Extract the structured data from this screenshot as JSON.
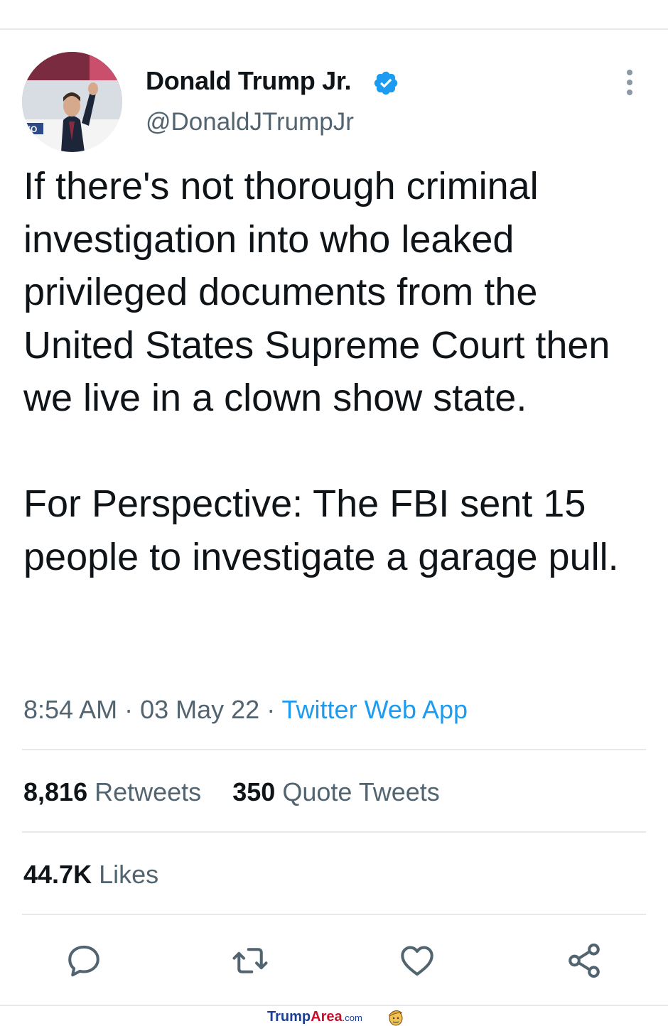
{
  "author": {
    "name": "Donald Trump Jr.",
    "handle": "@DonaldJTrumpJr",
    "verified": true,
    "avatar_icon": "profile-photo",
    "avatar_text": "YO"
  },
  "tweet": {
    "text": "If there's not thorough criminal investigation into who leaked privileged documents from the United States Supreme Court then we live in a clown show state.\n\nFor Perspective: The FBI sent 15 people to investigate a garage pull."
  },
  "meta": {
    "time": "8:54 AM",
    "date": "03 May 22",
    "separator": " · ",
    "source": "Twitter Web App"
  },
  "stats": {
    "retweets_count": "8,816",
    "retweets_label": "Retweets",
    "quotes_count": "350",
    "quotes_label": "Quote Tweets",
    "likes_count": "44.7K",
    "likes_label": "Likes"
  },
  "actions": [
    "reply-icon",
    "retweet-icon",
    "like-icon",
    "share-icon"
  ],
  "watermark": {
    "brand_part1": "Trump",
    "brand_part2": "Area",
    "suffix": ".com"
  },
  "colors": {
    "text": "#0f1419",
    "secondary": "#536471",
    "accent": "#1d9bf0",
    "divider": "#e6e9eb",
    "verified": "#1d9bf0"
  }
}
